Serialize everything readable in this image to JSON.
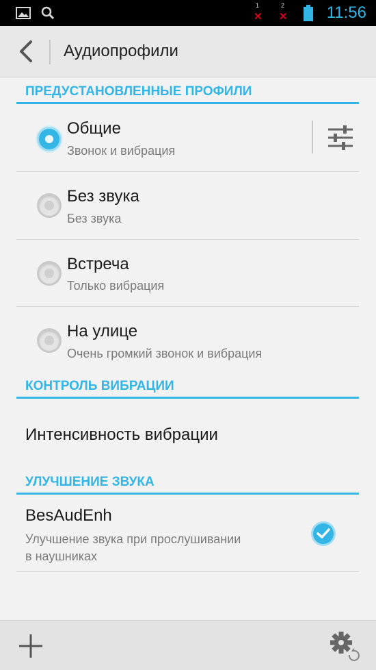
{
  "status_bar": {
    "time": "11:56",
    "sim1_label": "1",
    "sim2_label": "2",
    "icons": [
      "gallery-icon",
      "search-icon",
      "sim1-no-signal-icon",
      "sim2-no-signal-icon",
      "battery-icon"
    ]
  },
  "action_bar": {
    "title": "Аудиопрофили",
    "back_icon": "chevron-left-icon"
  },
  "sections": {
    "preset": {
      "header": "ПРЕДУСТАНОВЛЕННЫЕ ПРОФИЛИ"
    },
    "vibration": {
      "header": "КОНТРОЛЬ ВИБРАЦИИ"
    },
    "sound": {
      "header": "УЛУЧШЕНИЕ ЗВУКА"
    }
  },
  "profiles": [
    {
      "title": "Общие",
      "subtitle": "Звонок и вибрация",
      "selected": true
    },
    {
      "title": "Без звука",
      "subtitle": "Без звука",
      "selected": false
    },
    {
      "title": "Встреча",
      "subtitle": "Только вибрация",
      "selected": false
    },
    {
      "title": "На улице",
      "subtitle": "Очень громкий звонок и вибрация",
      "selected": false
    }
  ],
  "vibration_intensity": {
    "title": "Интенсивность вибрации"
  },
  "besaudenh": {
    "title": "BesAudEnh",
    "subtitle_line1": "Улучшение звука при прослушивании",
    "subtitle_line2": "в наушниках",
    "checked": true
  },
  "bottom_bar": {
    "add_icon": "plus-icon",
    "settings_icon": "gear-reset-icon"
  },
  "colors": {
    "accent": "#33b5e5",
    "status_bar": "#000000",
    "background": "#f2f2f2",
    "no_signal": "#d0021b"
  }
}
